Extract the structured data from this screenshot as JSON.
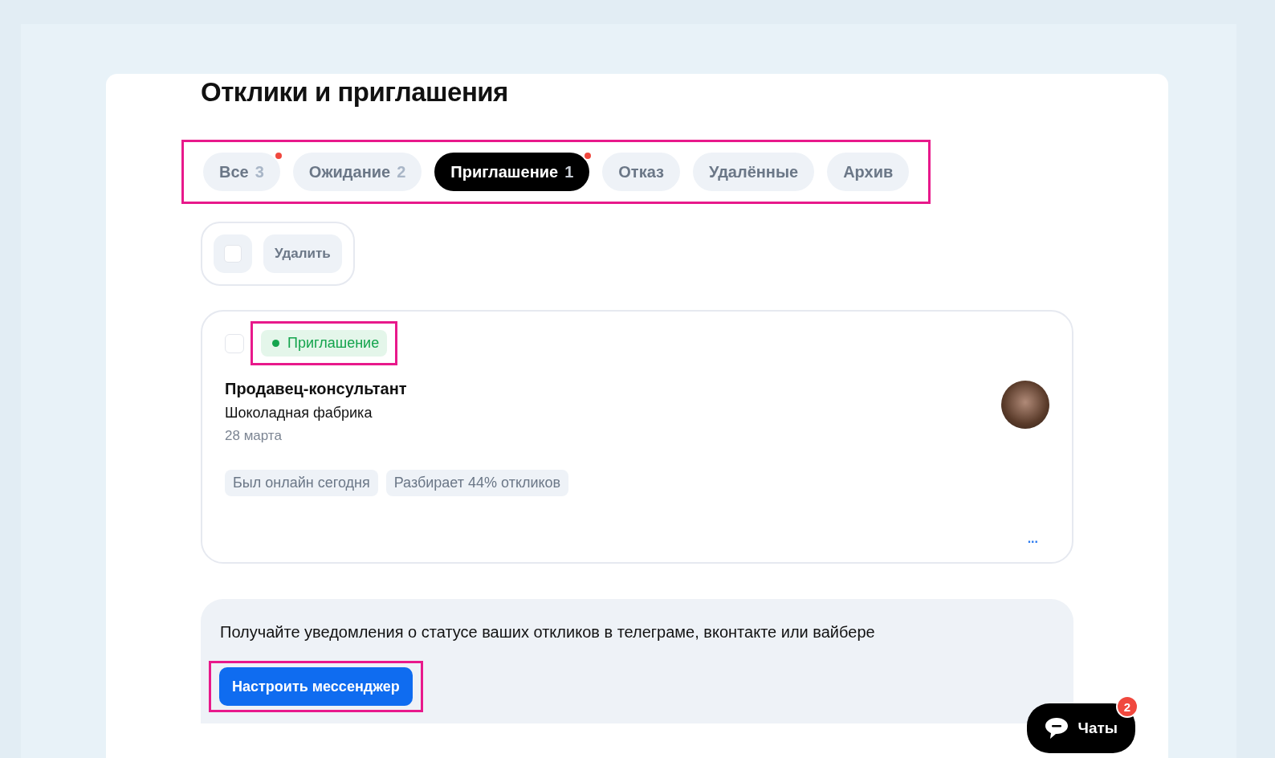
{
  "page": {
    "title": "Отклики и приглашения"
  },
  "tabs": {
    "highlighted": true,
    "items": [
      {
        "label": "Все",
        "count": "3",
        "selected": false,
        "unread": true
      },
      {
        "label": "Ожидание",
        "count": "2",
        "selected": false,
        "unread": false
      },
      {
        "label": "Приглашение",
        "count": "1",
        "selected": true,
        "unread": true
      },
      {
        "label": "Отказ",
        "selected": false,
        "unread": false
      },
      {
        "label": "Удалённые",
        "selected": false,
        "unread": false
      },
      {
        "label": "Архив",
        "selected": false,
        "unread": false
      }
    ]
  },
  "bulk_actions": {
    "select_all_checked": false,
    "delete_label": "Удалить"
  },
  "responses": [
    {
      "checked": false,
      "status": {
        "label": "Приглашение",
        "color": "#14a44d",
        "highlighted": true
      },
      "title": "Продавец-консультант",
      "company": "Шоколадная фабрика",
      "date": "28 марта",
      "tags": [
        "Был онлайн сегодня",
        "Разбирает 44% откликов"
      ],
      "more": "..."
    }
  ],
  "notification": {
    "text": "Получайте уведомления о статусе ваших откликов в телеграме, вконтакте или вайбере",
    "button": "Настроить мессенджер",
    "highlighted": true
  },
  "chats_button": {
    "label": "Чаты",
    "badge": "2"
  }
}
